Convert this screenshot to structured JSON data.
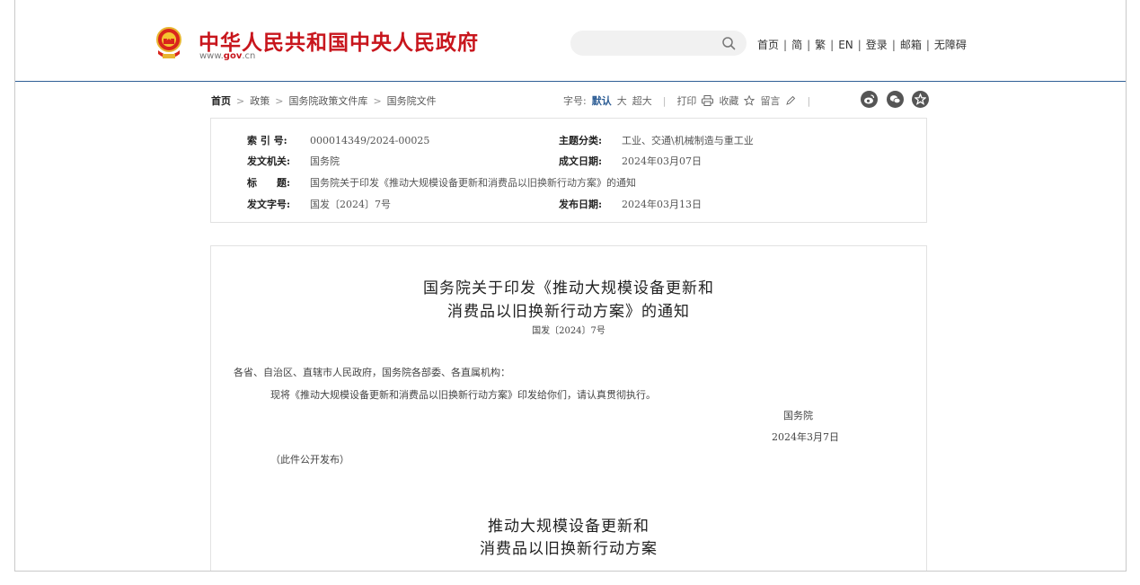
{
  "header": {
    "logo_title": "中华人民共和国中央人民政府",
    "logo_url_prefix": "www.",
    "logo_url_gov": "gov",
    "logo_url_suffix": ".cn",
    "search_placeholder": "",
    "nav": [
      "首页",
      "简",
      "繁",
      "EN",
      "登录",
      "邮箱",
      "无障碍"
    ]
  },
  "breadcrumb": {
    "items": [
      "首页",
      "政策",
      "国务院政策文件库",
      "国务院文件"
    ]
  },
  "tools": {
    "font_label": "字号:",
    "font_default": "默认",
    "font_large": "大",
    "font_xlarge": "超大",
    "print": "打印",
    "favorite": "收藏",
    "comment": "留言"
  },
  "info": {
    "index_key": "索 引 号:",
    "index_val": "000014349/2024-00025",
    "topic_key": "主题分类:",
    "topic_val": "工业、交通\\机械制造与重工业",
    "issuer_key": "发文机关:",
    "issuer_val": "国务院",
    "date_key": "成文日期:",
    "date_val": "2024年03月07日",
    "title_key": "标　　题:",
    "title_val": "国务院关于印发《推动大规模设备更新和消费品以旧换新行动方案》的通知",
    "docno_key": "发文字号:",
    "docno_val": "国发〔2024〕7号",
    "pub_key": "发布日期:",
    "pub_val": "2024年03月13日"
  },
  "document": {
    "title_line1": "国务院关于印发《推动大规模设备更新和",
    "title_line2": "消费品以旧换新行动方案》的通知",
    "doc_no": "国发〔2024〕7号",
    "salutation": "各省、自治区、直辖市人民政府，国务院各部委、各直属机构：",
    "body": "现将《推动大规模设备更新和消费品以旧换新行动方案》印发给你们，请认真贯彻执行。",
    "signer": "国务院",
    "sign_date": "2024年3月7日",
    "note": "（此件公开发布）",
    "plan_title_line1": "推动大规模设备更新和",
    "plan_title_line2": "消费品以旧换新行动方案"
  },
  "colors": {
    "brand_red": "#c8161d",
    "accent_blue": "#2f5f96"
  }
}
